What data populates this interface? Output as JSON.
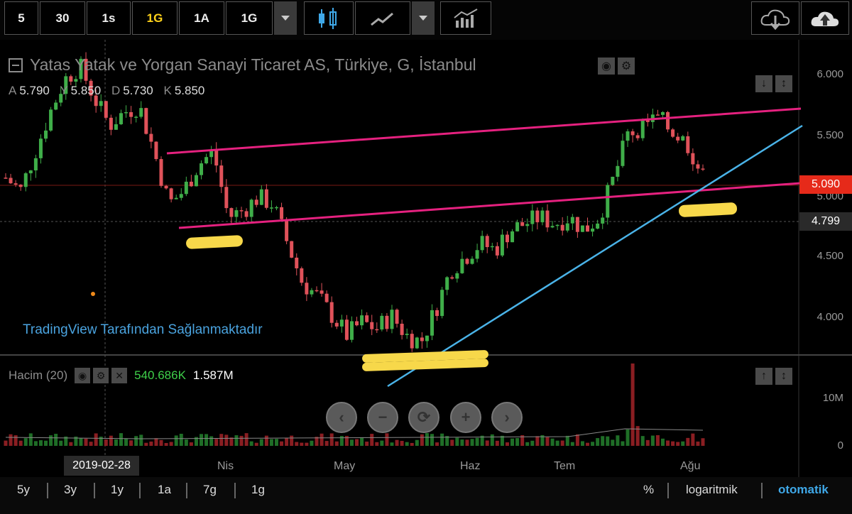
{
  "toolbar": {
    "intervals": [
      "5",
      "30",
      "1s",
      "1G",
      "1A",
      "1G"
    ],
    "active_interval": "1G",
    "icons": [
      "candlestick-icon",
      "area-chart-icon",
      "indicators-icon",
      "cloud-download-icon",
      "cloud-upload-icon"
    ]
  },
  "chart": {
    "title": "Yatas Yatak ve Yorgan Sanayi Ticaret AS, Türkiye, G, İstanbul",
    "ohlc": [
      {
        "key": "A",
        "value": "5.790"
      },
      {
        "key": "Y",
        "value": "5.850"
      },
      {
        "key": "D",
        "value": "5.730"
      },
      {
        "key": "K",
        "value": "5.850"
      }
    ],
    "watermark": "TradingView Tarafından Sağlanmaktadır",
    "price_ticks": [
      "6.000",
      "5.500",
      "5.000",
      "4.500",
      "4.000"
    ],
    "last_price": "5.090",
    "crosshair_price": "4.799",
    "crosshair_date": "2019-02-28",
    "date_ticks": [
      "Nis",
      "May",
      "Haz",
      "Tem",
      "Ağu"
    ],
    "colors": {
      "up": "#3fae49",
      "down": "#e0525a",
      "pink_line": "#e5217f",
      "blue_line": "#4ab3e8",
      "highlight": "#f7d84a",
      "last_price": "#e62a1a"
    }
  },
  "volume": {
    "label": "Hacim (20)",
    "value_green": "540.686K",
    "value_white": "1.587M",
    "ticks": [
      "10M",
      "0"
    ]
  },
  "nav_buttons": [
    "‹",
    "−",
    "⟳",
    "+",
    "›"
  ],
  "bottombar": {
    "ranges": [
      "5y",
      "3y",
      "1y",
      "1a",
      "7g",
      "1g"
    ],
    "percent": "%",
    "log": "logaritmik",
    "auto": "otomatik"
  },
  "chart_data": {
    "type": "candlestick",
    "title": "Yatas Yatak ve Yorgan Sanayi Ticaret AS, Türkiye, G, İstanbul",
    "x_ticks": [
      "Nis",
      "May",
      "Haz",
      "Tem",
      "Ağu"
    ],
    "ylim": [
      3.75,
      6.15
    ],
    "close_path": [
      5.1,
      5.0,
      5.3,
      5.6,
      5.85,
      5.95,
      5.7,
      5.5,
      5.6,
      5.65,
      5.3,
      4.9,
      5.0,
      5.2,
      5.3,
      4.8,
      4.85,
      4.95,
      4.9,
      4.6,
      4.3,
      4.2,
      4.05,
      3.9,
      4.0,
      3.95,
      4.05,
      3.9,
      3.85,
      4.1,
      4.4,
      4.5,
      4.6,
      4.55,
      4.7,
      4.75,
      4.8,
      4.75,
      4.8,
      4.7,
      4.8,
      5.1,
      5.45,
      5.5,
      5.55,
      5.45,
      5.35,
      5.1
    ],
    "lines": [
      {
        "color": "pink",
        "points": [
          [
            0,
            5.35
          ],
          [
            1,
            5.72
          ]
        ]
      },
      {
        "color": "pink",
        "points": [
          [
            0,
            4.78
          ],
          [
            1,
            5.1
          ]
        ]
      },
      {
        "color": "blue",
        "points": [
          [
            0,
            3.7
          ],
          [
            1,
            5.55
          ]
        ]
      }
    ]
  }
}
